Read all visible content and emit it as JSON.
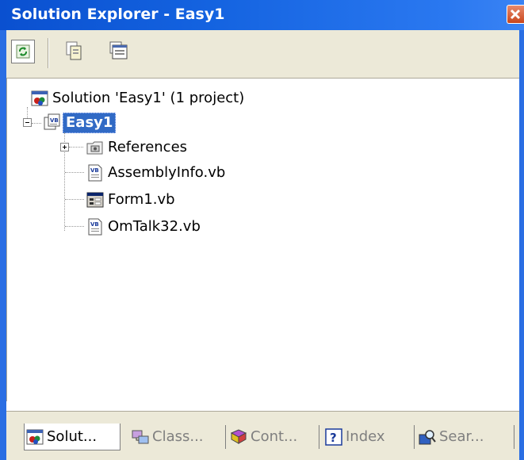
{
  "window": {
    "title": "Solution Explorer - Easy1",
    "close_icon": "close-icon"
  },
  "toolbar": {
    "buttons": [
      {
        "icon": "refresh-icon",
        "pressed": true
      },
      {
        "icon": "show-all-files-icon"
      },
      {
        "icon": "properties-icon"
      }
    ]
  },
  "tree": {
    "solution": {
      "label": "Solution 'Easy1' (1 project)",
      "icon": "solution-icon"
    },
    "project": {
      "label": "Easy1",
      "icon": "vb-project-icon",
      "expanded": true,
      "selected": true
    },
    "children": [
      {
        "label": "References",
        "icon": "references-icon",
        "expandable": true
      },
      {
        "label": "AssemblyInfo.vb",
        "icon": "vb-file-icon"
      },
      {
        "label": "Form1.vb",
        "icon": "form-icon"
      },
      {
        "label": "OmTalk32.vb",
        "icon": "vb-file-icon"
      }
    ]
  },
  "tabs": [
    {
      "label": "Solut...",
      "icon": "solution-icon",
      "active": true
    },
    {
      "label": "Class...",
      "icon": "class-view-icon"
    },
    {
      "label": "Cont...",
      "icon": "contents-icon"
    },
    {
      "label": "Index",
      "icon": "help-index-icon"
    },
    {
      "label": "Sear...",
      "icon": "search-icon"
    }
  ],
  "colors": {
    "title_bar": "#0a50d0",
    "selection": "#316ac5",
    "frame": "#2a6ee3",
    "panel_bg": "#ece9d8"
  }
}
